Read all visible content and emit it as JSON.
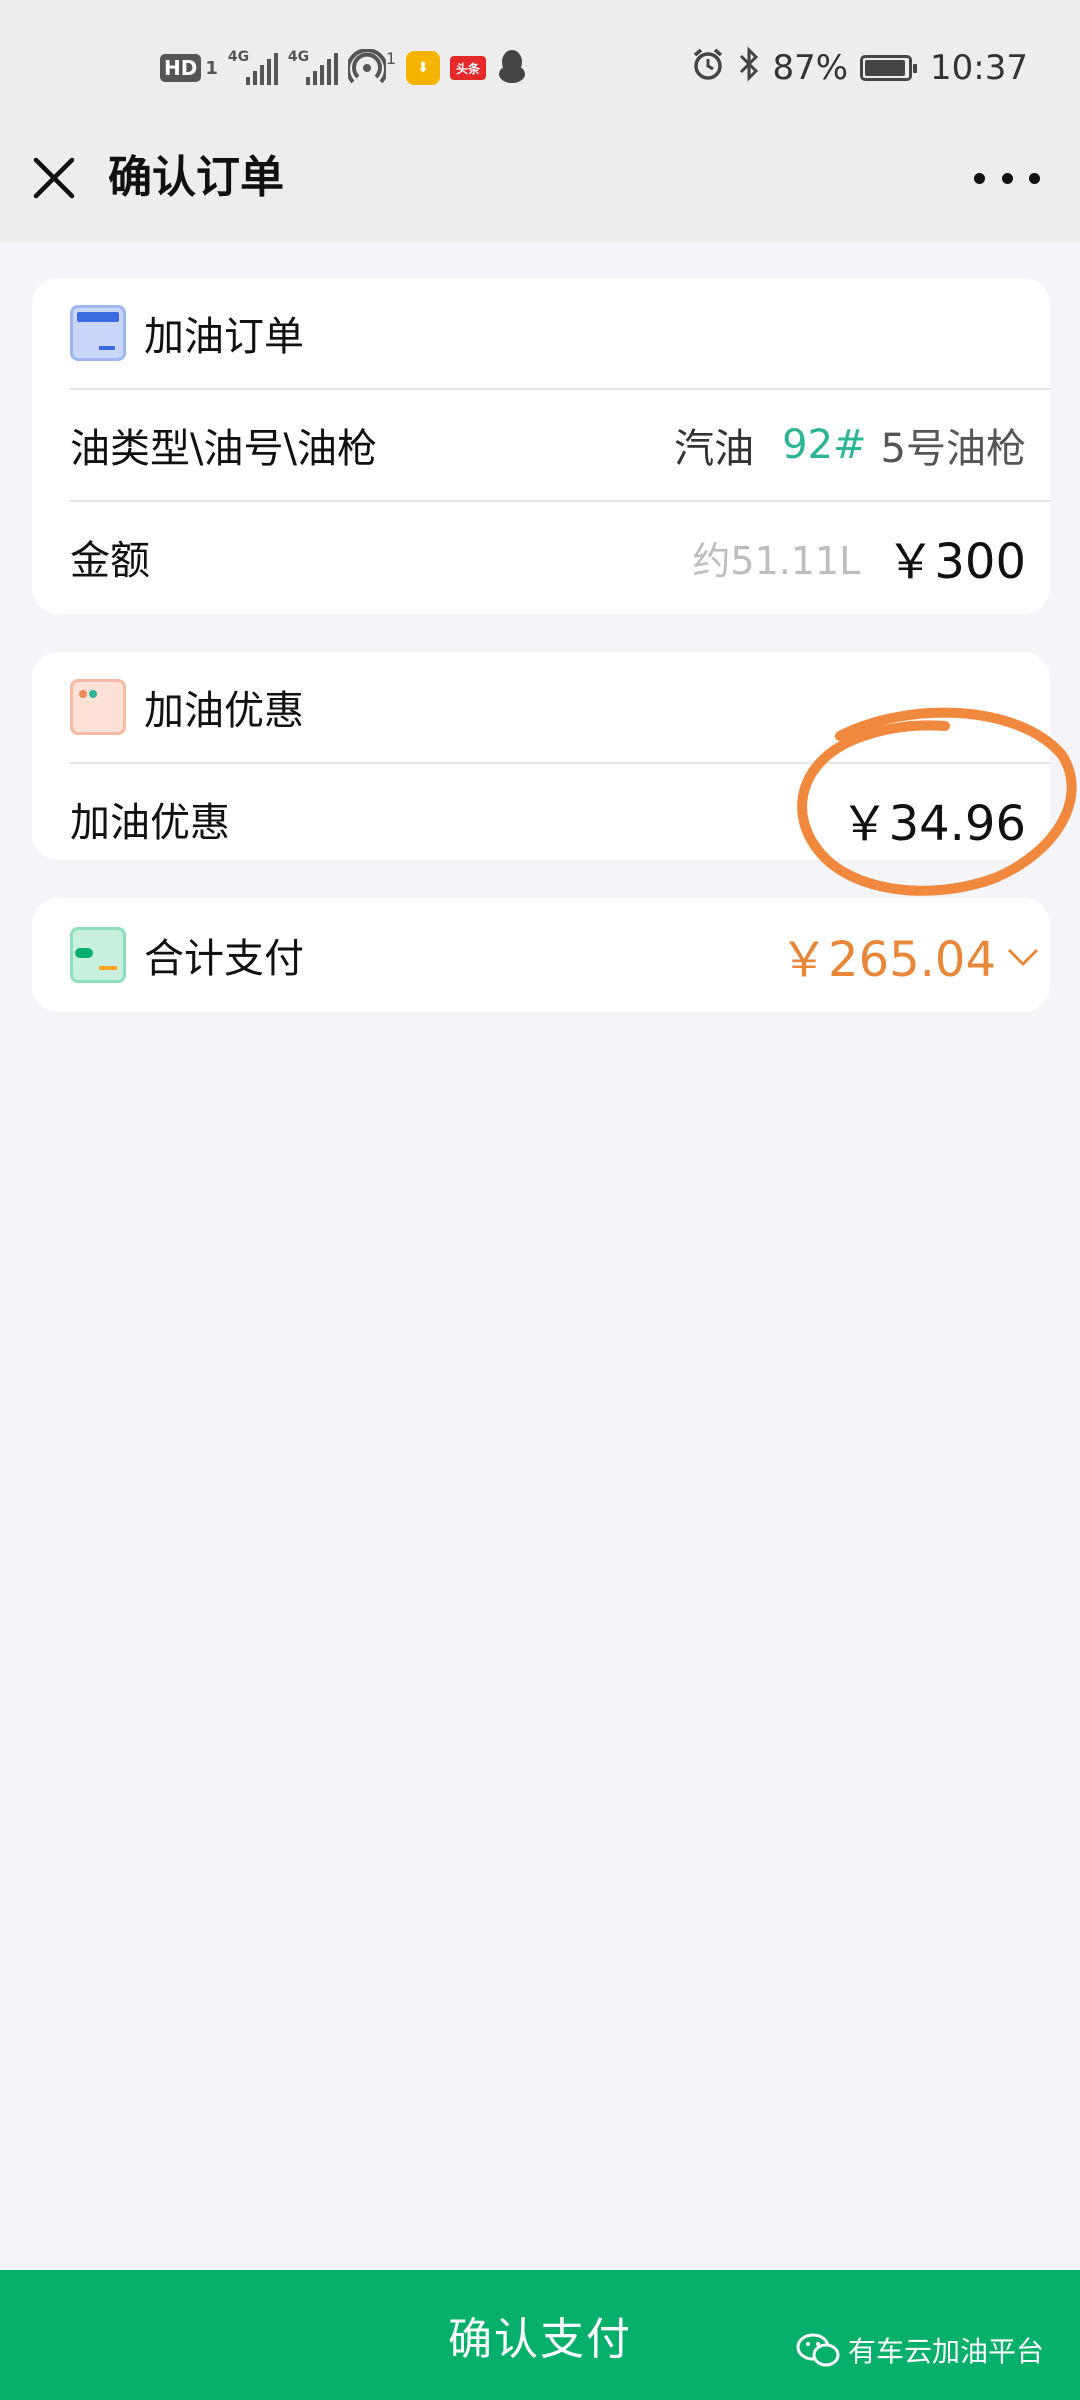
{
  "status_bar": {
    "hd": "HD",
    "hd_sub": "1",
    "signal1": "4G",
    "signal2": "4G",
    "hotspot_sub": "1",
    "app_badge": "头条",
    "battery": "87%",
    "time": "10:37"
  },
  "header": {
    "title": "确认订单"
  },
  "order_card": {
    "title": "加油订单",
    "fuel_row_label": "油类型\\油号\\油枪",
    "fuel_type": "汽油",
    "fuel_grade": "92#",
    "gun": "5号油枪",
    "amount_label": "金额",
    "volume": "约51.11L",
    "amount": "￥300"
  },
  "discount_card": {
    "title": "加油优惠",
    "row_label": "加油优惠",
    "value": "￥34.96"
  },
  "total_card": {
    "title": "合计支付",
    "value": "￥265.04"
  },
  "footer": {
    "confirm_label": "确认支付",
    "watermark": "有车云加油平台"
  },
  "colors": {
    "accent_green": "#07b06a",
    "grade_teal": "#2bb594",
    "total_orange": "#e8873a",
    "annotation_orange": "#f0893d"
  }
}
